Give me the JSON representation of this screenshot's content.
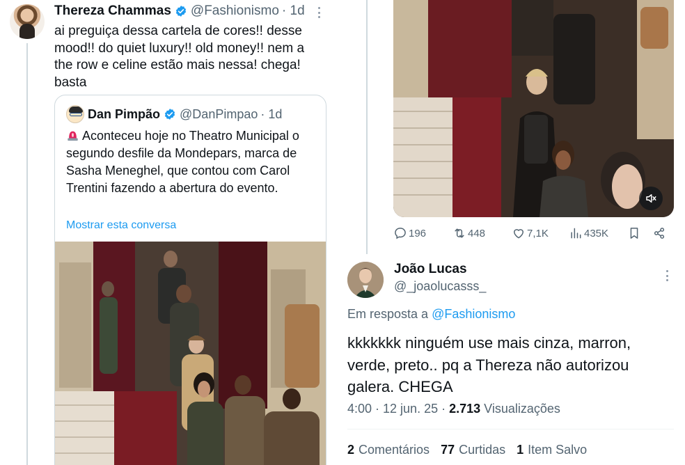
{
  "tweet": {
    "author_name": "Thereza Chammas",
    "author_handle": "@Fashionismo",
    "time": "· 1d",
    "text": "ai preguiça dessa cartela de cores!! desse mood!! do quiet luxury!! old money!! nem a the row e celine estão mais nessa! chega! basta"
  },
  "quote": {
    "author_name": "Dan Pimpão",
    "author_handle": "@DanPimpao",
    "time": "· 1d",
    "text": "Aconteceu hoje no Theatro Municipal o segundo desfile da Mondepars, marca de Sasha Meneghel, que contou com Carol Trentini fazendo a abertura do evento.",
    "show_thread_link": "Mostrar esta conversa"
  },
  "actions": {
    "replies": "196",
    "retweets": "448",
    "likes": "7,1K",
    "views": "435K"
  },
  "reply": {
    "author_name": "João Lucas",
    "author_handle": "@_joaolucasss_",
    "reply_to_prefix": "Em resposta a",
    "reply_to_mention": "@Fashionismo",
    "text": "kkkkkkk ninguém use mais cinza, marron, verde, preto.. pq a Thereza não autorizou galera. CHEGA",
    "time": "4:00 · 12 jun. 25 ·",
    "views_count": "2.713",
    "views_label": "Visualizações",
    "comments_count": "2",
    "comments_label": "Comentários",
    "likes_count": "77",
    "likes_label": "Curtidas",
    "saves_count": "1",
    "saves_label": "Item Salvo"
  },
  "colors": {
    "accent": "#1d9bf0",
    "text_primary": "#0f1419",
    "text_secondary": "#536471",
    "border": "#cfd9de"
  },
  "icons": [
    "verified-badge-icon",
    "more-options-icon",
    "police-light-icon",
    "reply-icon",
    "retweet-icon",
    "like-icon",
    "views-icon",
    "bookmark-icon",
    "share-icon",
    "mute-icon"
  ]
}
